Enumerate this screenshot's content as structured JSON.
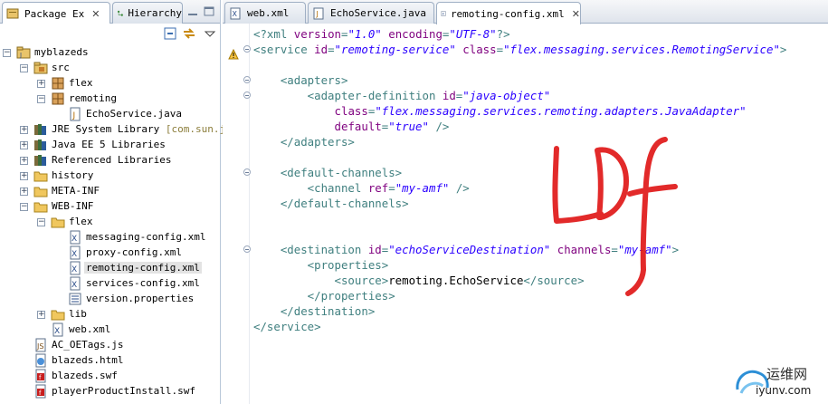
{
  "left_tabs": [
    {
      "label": "Package Ex",
      "active": true
    },
    {
      "label": "Hierarchy",
      "active": false
    }
  ],
  "tree": [
    {
      "label": "myblazeds",
      "level": 0,
      "icon": "project",
      "expanded": true
    },
    {
      "label": "src",
      "level": 1,
      "icon": "source-folder",
      "expanded": true
    },
    {
      "label": "flex",
      "level": 2,
      "icon": "package",
      "expanded": false
    },
    {
      "label": "remoting",
      "level": 2,
      "icon": "package",
      "expanded": true
    },
    {
      "label": "EchoService.java",
      "level": 3,
      "icon": "java-file",
      "expanded": false
    },
    {
      "label": "JRE System Library",
      "decoration": " [com.sun.jav",
      "level": 1,
      "icon": "library",
      "expanded": false
    },
    {
      "label": "Java EE 5 Libraries",
      "level": 1,
      "icon": "library",
      "expanded": false
    },
    {
      "label": "Referenced Libraries",
      "level": 1,
      "icon": "library",
      "expanded": false
    },
    {
      "label": "history",
      "level": 1,
      "icon": "folder",
      "expanded": false
    },
    {
      "label": "META-INF",
      "level": 1,
      "icon": "folder",
      "expanded": false
    },
    {
      "label": "WEB-INF",
      "level": 1,
      "icon": "folder",
      "expanded": true
    },
    {
      "label": "flex",
      "level": 2,
      "icon": "folder",
      "expanded": true
    },
    {
      "label": "messaging-config.xml",
      "level": 3,
      "icon": "xml-file"
    },
    {
      "label": "proxy-config.xml",
      "level": 3,
      "icon": "xml-file"
    },
    {
      "label": "remoting-config.xml",
      "level": 3,
      "icon": "xml-file",
      "selected": true
    },
    {
      "label": "services-config.xml",
      "level": 3,
      "icon": "xml-file"
    },
    {
      "label": "version.properties",
      "level": 3,
      "icon": "properties-file"
    },
    {
      "label": "lib",
      "level": 2,
      "icon": "folder",
      "expanded": false
    },
    {
      "label": "web.xml",
      "level": 2,
      "icon": "xml-file"
    },
    {
      "label": "AC_OETags.js",
      "level": 1,
      "icon": "js-file"
    },
    {
      "label": "blazeds.html",
      "level": 1,
      "icon": "html-file"
    },
    {
      "label": "blazeds.swf",
      "level": 1,
      "icon": "swf-file"
    },
    {
      "label": "playerProductInstall.swf",
      "level": 1,
      "icon": "swf-file"
    }
  ],
  "editor_tabs": [
    {
      "label": "web.xml",
      "icon": "xml-file",
      "active": false
    },
    {
      "label": "EchoService.java",
      "icon": "java-file",
      "active": false
    },
    {
      "label": "remoting-config.xml",
      "icon": "xml-file",
      "active": true
    }
  ],
  "code": [
    [
      [
        "tag",
        "<?xml "
      ],
      [
        "attr",
        "version"
      ],
      [
        "tag",
        "="
      ],
      [
        "val",
        "\"1.0\""
      ],
      [
        "tag",
        " "
      ],
      [
        "attr",
        "encoding"
      ],
      [
        "tag",
        "="
      ],
      [
        "val",
        "\"UTF-8\""
      ],
      [
        "tag",
        "?>"
      ]
    ],
    [
      [
        "tag",
        "<service "
      ],
      [
        "attr",
        "id"
      ],
      [
        "tag",
        "="
      ],
      [
        "val",
        "\"remoting-service\""
      ],
      [
        "tag",
        " "
      ],
      [
        "attr",
        "class"
      ],
      [
        "tag",
        "="
      ],
      [
        "val",
        "\"flex.messaging.services.RemotingService\""
      ],
      [
        "tag",
        ">"
      ]
    ],
    [],
    [
      [
        "tag",
        "    <adapters>"
      ]
    ],
    [
      [
        "tag",
        "        <adapter-definition "
      ],
      [
        "attr",
        "id"
      ],
      [
        "tag",
        "="
      ],
      [
        "val",
        "\"java-object\""
      ]
    ],
    [
      [
        "tag",
        "            "
      ],
      [
        "attr",
        "class"
      ],
      [
        "tag",
        "="
      ],
      [
        "val",
        "\"flex.messaging.services.remoting.adapters.JavaAdapter\""
      ]
    ],
    [
      [
        "tag",
        "            "
      ],
      [
        "attr",
        "default"
      ],
      [
        "tag",
        "="
      ],
      [
        "val",
        "\"true\""
      ],
      [
        "tag",
        " />"
      ]
    ],
    [
      [
        "tag",
        "    </adapters>"
      ]
    ],
    [],
    [
      [
        "tag",
        "    <default-channels>"
      ]
    ],
    [
      [
        "tag",
        "        <channel "
      ],
      [
        "attr",
        "ref"
      ],
      [
        "tag",
        "="
      ],
      [
        "val",
        "\"my-amf\""
      ],
      [
        "tag",
        " />"
      ]
    ],
    [
      [
        "tag",
        "    </default-channels>"
      ]
    ],
    [],
    [],
    [
      [
        "tag",
        "    <destination "
      ],
      [
        "attr",
        "id"
      ],
      [
        "tag",
        "="
      ],
      [
        "val",
        "\"echoServiceDestination\""
      ],
      [
        "tag",
        " "
      ],
      [
        "attr",
        "channels"
      ],
      [
        "tag",
        "="
      ],
      [
        "val",
        "\"my-amf\""
      ],
      [
        "tag",
        ">"
      ]
    ],
    [
      [
        "tag",
        "        <properties>"
      ]
    ],
    [
      [
        "tag",
        "            <source>"
      ],
      [
        "txt",
        "remoting.EchoService"
      ],
      [
        "tag",
        "</source>"
      ]
    ],
    [
      [
        "tag",
        "        </properties>"
      ]
    ],
    [
      [
        "tag",
        "    </destination>"
      ]
    ],
    [
      [
        "tag",
        "</service>"
      ]
    ]
  ],
  "fold_lines": [
    1,
    3,
    4,
    9,
    14
  ],
  "handwriting": "LDf",
  "watermark": {
    "line1": "运维网",
    "line2": "iyunv.com"
  },
  "colors": {
    "tag": "#3f7f7f",
    "attr": "#7f007f",
    "value": "#2a00ff",
    "handwriting": "#e01818",
    "selection": "#e3e3e3"
  }
}
